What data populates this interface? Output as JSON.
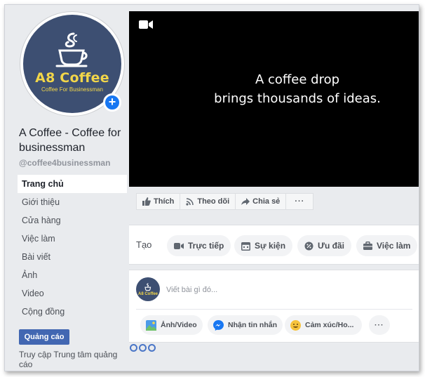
{
  "page": {
    "avatar": {
      "brand": "A8 Coffee",
      "tagline": "Coffee For Businessman"
    },
    "name": "A Coffee - Coffee for businessman",
    "username": "@coffee4businessman"
  },
  "nav": {
    "items": [
      "Trang chủ",
      "Giới thiệu",
      "Cửa hàng",
      "Việc làm",
      "Bài viết",
      "Ảnh",
      "Video",
      "Cộng đồng"
    ],
    "active": "Trang chủ"
  },
  "ads": {
    "button_label": "Quảng cáo",
    "link_text": "Truy cập Trung tâm quảng cáo"
  },
  "cover": {
    "line1": "A coffee drop",
    "line2": "brings thousands of ideas.",
    "icon": "video-camera-icon"
  },
  "actions": {
    "like": "Thích",
    "follow": "Theo dõi",
    "share": "Chia sẻ",
    "more": "···"
  },
  "create": {
    "label": "Tạo",
    "live": "Trực tiếp",
    "event": "Sự kiện",
    "offer": "Ưu đãi",
    "job": "Việc làm"
  },
  "composer": {
    "placeholder": "Viết bài gì đó...",
    "mini_brand": "A8 Coffee",
    "photo": "Ảnh/Video",
    "message": "Nhận tin nhắn",
    "feeling": "Cảm xúc/Ho...",
    "more": "···"
  },
  "colors": {
    "accent": "#1877f2",
    "ads_button": "#4267b2",
    "avatar_bg": "#3d4f72",
    "brand_yellow": "#f2d649"
  }
}
